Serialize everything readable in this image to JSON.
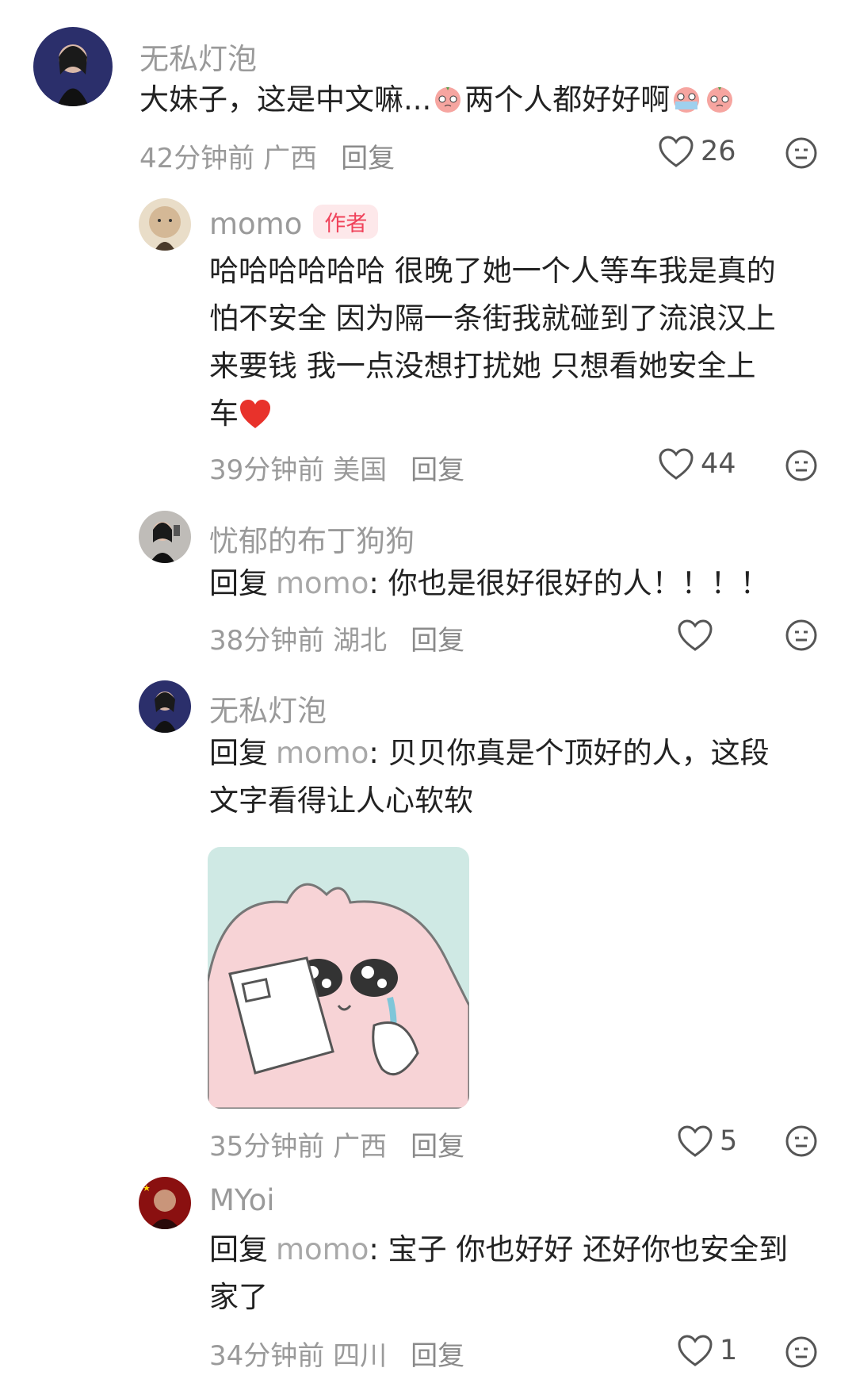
{
  "comments": [
    {
      "name": "无私灯泡",
      "text": "大妹子，这是中文嘛...",
      "text_after": "两个人都好好啊",
      "time": "42分钟前 广西",
      "reply": "回复",
      "likes": "26"
    },
    {
      "name": "momo",
      "badge": "作者",
      "lines": [
        "哈哈哈哈哈哈 很晚了她一个人等车我是真的",
        "怕不安全 因为隔一条街我就碰到了流浪汉上",
        "来要钱 我一点没想打扰她  只想看她安全上",
        "车"
      ],
      "time": "39分钟前 美国",
      "reply": "回复",
      "likes": "44"
    },
    {
      "name": "忧郁的布丁狗狗",
      "reply_prefix": "回复",
      "reply_to": "momo",
      "text": ": 你也是很好很好的人！！！！",
      "time": "38分钟前 湖北",
      "reply": "回复"
    },
    {
      "name": "无私灯泡",
      "reply_prefix": "回复",
      "reply_to": "momo",
      "line1": ": 贝贝你真是个顶好的人，这段",
      "line2": "文字看得让人心软软",
      "time": "35分钟前 广西",
      "reply": "回复",
      "likes": "5"
    },
    {
      "name": "MYoi",
      "reply_prefix": "回复",
      "reply_to": "momo",
      "line1": ": 宝子 你也好好 还好你也安全到",
      "line2": "家了",
      "time": "34分钟前 四川",
      "reply": "回复",
      "likes": "1"
    }
  ],
  "colors": {
    "badge_bg": "#fde8ea",
    "badge_text": "#f0435b",
    "heart_red": "#e8322b",
    "meta_gray": "#9a9a9a",
    "sticker_bg": "#cfe9e4"
  },
  "icons": [
    "heart-outline-icon",
    "emoji-face-icon",
    "peach-crying-emoji",
    "red-heart-emoji"
  ]
}
